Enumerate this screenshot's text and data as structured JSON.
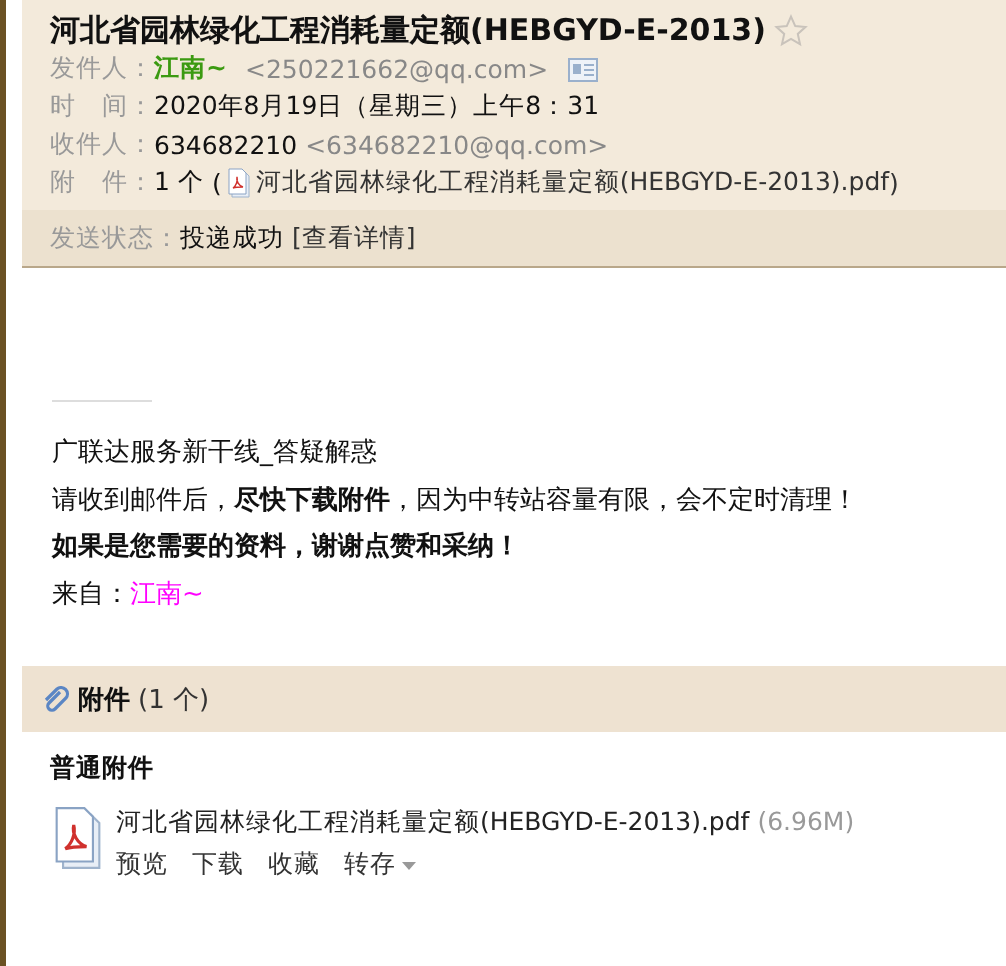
{
  "subject": "河北省园林绿化工程消耗量定额(HEBGYD-E-2013)",
  "starred": false,
  "fields": [
    {
      "kind": "sender",
      "label": "发件人：",
      "name": "江南~",
      "address": "<250221662@qq.com>"
    },
    {
      "kind": "text",
      "label": "时　间：",
      "value": "2020年8月19日（星期三）上午8：31"
    },
    {
      "kind": "recipient",
      "label": "收件人：",
      "name": "634682210",
      "address": "<634682210@qq.com>"
    },
    {
      "kind": "attachment",
      "label": "附　件：",
      "count": "1 个",
      "open": "(",
      "file": "河北省园林绿化工程消耗量定额(HEBGYD-E-2013).pdf",
      "close": ")"
    }
  ],
  "status": {
    "label": "发送状态：",
    "value": "投递成功",
    "link": "[查看详情]"
  },
  "body": [
    {
      "kind": "plain",
      "text": "广联达服务新干线_答疑解惑"
    },
    {
      "kind": "plain",
      "text": "请收到邮件后，**尽快下载附件**，因为中转站容量有限，会不定时清理！"
    },
    {
      "kind": "bold",
      "text": "如果是您需要的资料，谢谢点赞和采纳！"
    },
    {
      "kind": "from",
      "text": "来自：",
      "link": "江南~"
    }
  ],
  "attachments": {
    "title": "附件",
    "count": "(1 个)",
    "section": "普通附件",
    "files": [
      {
        "name": "河北省园林绿化工程消耗量定额(HEBGYD-E-2013).pdf",
        "size": "(6.96M)",
        "actions": [
          {
            "label": "预览",
            "menu": false
          },
          {
            "label": "下载",
            "menu": false
          },
          {
            "label": "收藏",
            "menu": false
          },
          {
            "label": "转存",
            "menu": true
          }
        ]
      }
    ]
  }
}
